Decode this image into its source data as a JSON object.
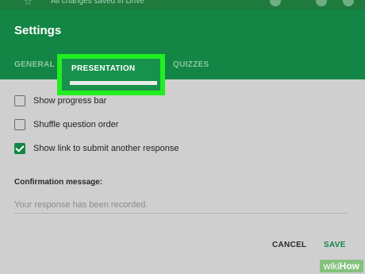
{
  "topbar": {
    "status_text": "All changes saved in Drive",
    "colors": {
      "background": "#1f7a3d"
    }
  },
  "dialog": {
    "title": "Settings",
    "tabs": [
      {
        "label": "GENERAL",
        "active": false
      },
      {
        "label": "PRESENTATION",
        "active": true
      },
      {
        "label": "QUIZZES",
        "active": false
      }
    ],
    "options": [
      {
        "label": "Show progress bar",
        "checked": false
      },
      {
        "label": "Shuffle question order",
        "checked": false
      },
      {
        "label": "Show link to submit another response",
        "checked": true
      }
    ],
    "confirmation": {
      "label": "Confirmation message:",
      "value": "Your response has been recorded."
    },
    "buttons": {
      "cancel": "CANCEL",
      "save": "SAVE"
    },
    "colors": {
      "header": "#138545",
      "highlight_box": "#22ee22",
      "accent": "#138545"
    }
  },
  "watermark": {
    "part1": "wiki",
    "part2": "How"
  }
}
